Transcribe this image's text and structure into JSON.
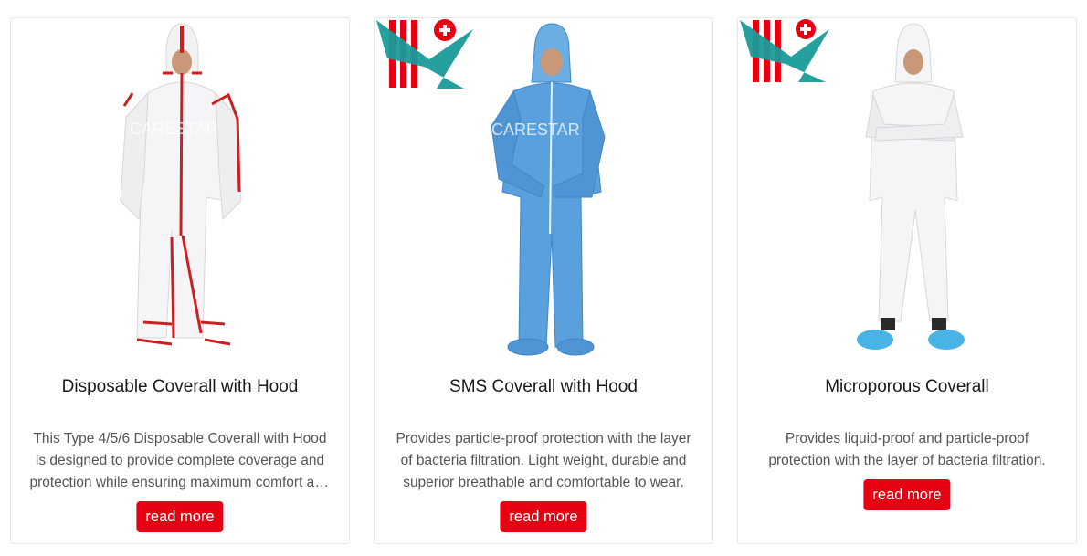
{
  "products": [
    {
      "title": "Disposable Coverall with Hood",
      "description": "This Type 4/5/6 Disposable Coverall with Hood is designed to provide complete coverage and protection while ensuring maximum comfort and freedom of movement.",
      "button_label": "read more",
      "image_icon": "white-coverall-red-tape-photo"
    },
    {
      "title": "SMS Coverall with Hood",
      "description": "Provides particle-proof protection with the layer of bacteria filtration. Light weight, durable and superior breathable and comfortable to wear.",
      "button_label": "read more",
      "image_icon": "blue-coverall-photo"
    },
    {
      "title": "Microporous Coverall",
      "description": "Provides liquid-proof and particle-proof protection with the layer of bacteria filtration.",
      "button_label": "read more",
      "image_icon": "white-coverall-photo"
    }
  ],
  "watermark_text": "CARESTAR",
  "colors": {
    "button": "#e60012",
    "logo_red": "#e60012",
    "logo_teal": "#1a9a9a",
    "blue_suit": "#5aa0dc",
    "card_border": "#e6e6e6"
  }
}
